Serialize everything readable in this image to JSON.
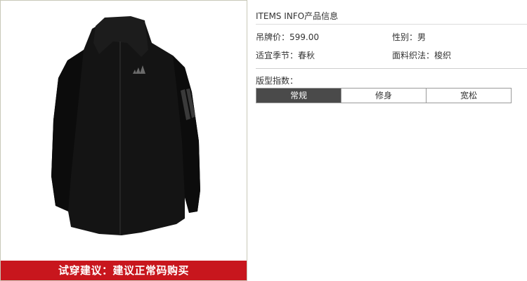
{
  "product": {
    "image_alt": "adidas black hooded jacket",
    "fit_advice": "试穿建议：建议正常码购买"
  },
  "info": {
    "title": "ITEMS INFO产品信息",
    "attributes": {
      "price_label": "吊牌价：",
      "price_value": "599.00",
      "gender_label": "性别：",
      "gender_value": "男",
      "season_label": "适宜季节：",
      "season_value": "春秋",
      "fabric_label": "面料织法：",
      "fabric_value": "梭织"
    },
    "fit": {
      "label": "版型指数：",
      "options": [
        {
          "label": "常规",
          "selected": true
        },
        {
          "label": "修身",
          "selected": false
        },
        {
          "label": "宽松",
          "selected": false
        }
      ]
    }
  },
  "colors": {
    "banner": "#c8161d",
    "selected_fit": "#4a4a4a",
    "jacket": "#141414"
  }
}
